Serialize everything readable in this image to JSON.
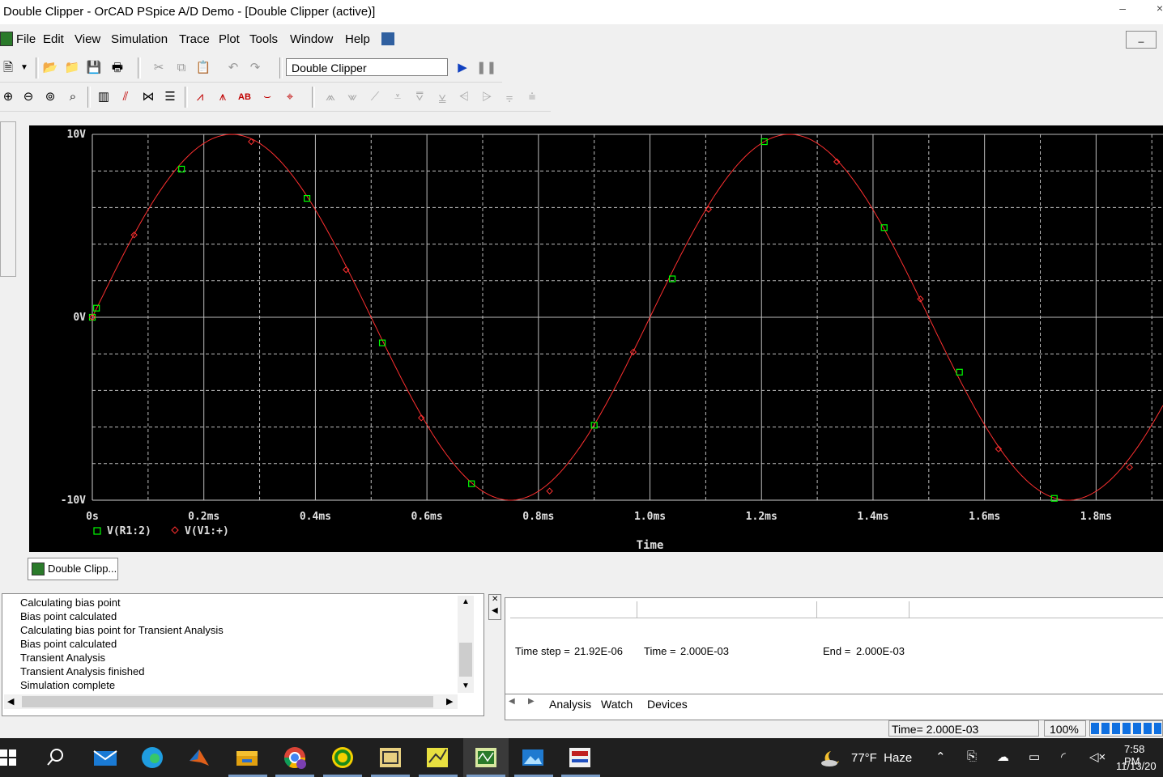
{
  "window": {
    "title": "Double Clipper - OrCAD PSpice A/D Demo  - [Double Clipper (active)]",
    "minimize_glyph": "–",
    "close_glyph": "×"
  },
  "menubar": {
    "items": [
      "File",
      "Edit",
      "View",
      "Simulation",
      "Trace",
      "Plot",
      "Tools",
      "Window",
      "Help"
    ]
  },
  "toolbar": {
    "profile_name": "Double Clipper",
    "run_icon": "play-icon",
    "pause_icon": "pause-icon",
    "file_icons": [
      "new-icon",
      "open-icon",
      "open-folder-icon",
      "save-icon",
      "print-icon"
    ],
    "edit_icons": [
      "cut-icon",
      "copy-icon",
      "paste-icon",
      "undo-icon",
      "redo-icon"
    ],
    "view_icons": [
      "zoom-in-icon",
      "zoom-out-icon",
      "zoom-area-icon",
      "zoom-fit-icon",
      "axis-icon",
      "log-x-icon",
      "fourier-icon",
      "performance-icon",
      "add-trace-icon",
      "trace-func-icon",
      "label-icon",
      "mark-data-icon",
      "cursor-icon"
    ],
    "cursor_icons": [
      "cursor-peak-icon",
      "cursor-trough-icon",
      "cursor-slope-icon",
      "cursor-min-icon",
      "cursor-max-icon",
      "cursor-point-icon",
      "cursor-search-icon",
      "cursor-next-icon",
      "cursor-prev-icon",
      "cursor-mark-icon"
    ]
  },
  "chart_data": {
    "type": "line",
    "x_unit": "ms",
    "xlabel": "Time",
    "x_ticks": [
      "0s",
      "0.2ms",
      "0.4ms",
      "0.6ms",
      "0.8ms",
      "1.0ms",
      "1.2ms",
      "1.4ms",
      "1.6ms",
      "1.8ms"
    ],
    "y_ticks": [
      "10V",
      "0V",
      "-10V"
    ],
    "xlim": [
      0,
      1.92
    ],
    "ylim": [
      -10,
      10
    ],
    "grid": true,
    "background": "#000000",
    "series": [
      {
        "name": "V(R1:2)",
        "color": "#ff3030",
        "marker": "square",
        "marker_color": "#00ff00",
        "x": [
          0.0,
          0.0075,
          0.16,
          0.385,
          0.52,
          0.68,
          0.9,
          1.04,
          1.205,
          1.42,
          1.555,
          1.725
        ],
        "y": [
          0.0,
          0.5,
          8.1,
          6.5,
          -1.4,
          -9.1,
          -5.9,
          2.1,
          9.6,
          4.9,
          -3.0,
          -9.9
        ]
      },
      {
        "name": "V(V1:+)",
        "color": "#ff3030",
        "marker": "diamond",
        "marker_color": "#ff3030",
        "x": [
          0.0,
          0.075,
          0.285,
          0.455,
          0.59,
          0.82,
          0.97,
          1.105,
          1.335,
          1.485,
          1.625,
          1.86
        ],
        "y": [
          0.0,
          4.5,
          9.6,
          2.6,
          -5.5,
          -9.5,
          -1.9,
          5.9,
          8.5,
          1.0,
          -7.2,
          -8.2
        ]
      }
    ],
    "function": "10*sin(2*pi*1kHz*t)"
  },
  "doc_tab": {
    "label": "Double Clipp..."
  },
  "output_log": {
    "lines": [
      "Calculating bias point",
      "Bias point calculated",
      "Calculating bias point for Transient Analysis",
      "Bias point calculated",
      "Transient Analysis",
      "Transient Analysis finished",
      "Simulation complete"
    ]
  },
  "sim_status": {
    "time_step_label": "Time step =",
    "time_step_value": "21.92E-06",
    "time_label": "Time =",
    "time_value": "2.000E-03",
    "end_label": "End =",
    "end_value": "2.000E-03",
    "tabs": [
      "Analysis",
      "Watch",
      "Devices"
    ]
  },
  "statusbar": {
    "time_text": "Time= 2.000E-03",
    "zoom": "100%",
    "progress": 1.0
  },
  "taskbar": {
    "apps": [
      "windows-start-icon",
      "search-icon",
      "mail-icon",
      "edge-icon",
      "matlab-icon",
      "file-explorer-icon",
      "chrome-icon",
      "sync-icon",
      "capture-icon",
      "pspice-model-icon",
      "pspice-probe-icon",
      "photos-icon",
      "stimulus-icon"
    ],
    "weather": "77°F  Haze",
    "tray_icons": [
      "chevron-up-icon",
      "meet-icon",
      "cloud-icon",
      "battery-icon",
      "wifi-icon",
      "volume-icon"
    ],
    "time": "7:58 PM",
    "date": "11/13/20"
  }
}
